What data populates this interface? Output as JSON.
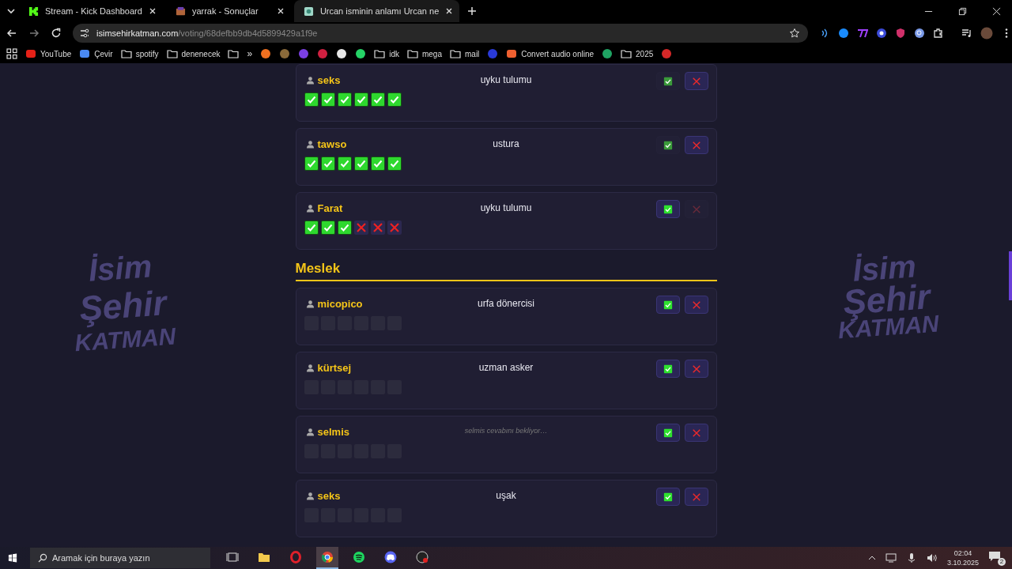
{
  "browser": {
    "tabs": [
      {
        "title": "Stream - Kick Dashboard",
        "selected": false
      },
      {
        "title": "yarrak - Sonuçlar",
        "selected": false
      },
      {
        "title": "Urcan isminin anlamı Urcan ne",
        "selected": true
      }
    ],
    "url": {
      "domain": "isimsehirkatman.com",
      "path": "/voting/68defbb9db4d5899429a1f9e"
    },
    "bookmarks": [
      {
        "kind": "site",
        "label": "YouTube",
        "color": "#e62117"
      },
      {
        "kind": "site",
        "label": "Çevir",
        "color": "#4a8af4"
      },
      {
        "kind": "folder",
        "label": "spotify"
      },
      {
        "kind": "folder",
        "label": "denenecek"
      },
      {
        "kind": "folder"
      },
      {
        "kind": "more",
        "label": "»"
      },
      {
        "kind": "icon",
        "color": "#f07020"
      },
      {
        "kind": "icon",
        "color": "#8a6a3a"
      },
      {
        "kind": "icon",
        "color": "#7b3fe4"
      },
      {
        "kind": "icon",
        "color": "#d02040"
      },
      {
        "kind": "icon",
        "color": "#e8e8e8"
      },
      {
        "kind": "icon",
        "color": "#25d366"
      },
      {
        "kind": "folder",
        "label": "idk"
      },
      {
        "kind": "folder",
        "label": "mega"
      },
      {
        "kind": "folder",
        "label": "mail"
      },
      {
        "kind": "icon",
        "color": "#2a3ad8"
      },
      {
        "kind": "site",
        "label": "Convert audio online",
        "color": "#f06030"
      },
      {
        "kind": "icon",
        "color": "#1fa463"
      },
      {
        "kind": "folder",
        "label": "2025"
      },
      {
        "kind": "icon",
        "color": "#d62828"
      }
    ]
  },
  "background_logos": [
    {
      "lines": [
        "İsim",
        "Şehir",
        "KATMAN"
      ]
    },
    {
      "lines": [
        "İsim",
        "Şehir",
        "KATMAN"
      ]
    }
  ],
  "sections": [
    {
      "cards": [
        {
          "name": "seks",
          "answer": "uyku tulumu",
          "pending": false,
          "approve_on": false,
          "reject_on": true,
          "votes": [
            {
              "kind": "yes"
            },
            {
              "kind": "yes"
            },
            {
              "kind": "yes"
            },
            {
              "kind": "yes"
            },
            {
              "kind": "yes"
            },
            {
              "kind": "yes"
            }
          ]
        },
        {
          "name": "tawso",
          "answer": "ustura",
          "pending": false,
          "approve_on": false,
          "reject_on": true,
          "votes": [
            {
              "kind": "yes"
            },
            {
              "kind": "yes"
            },
            {
              "kind": "yes"
            },
            {
              "kind": "yes"
            },
            {
              "kind": "yes"
            },
            {
              "kind": "yes"
            }
          ]
        },
        {
          "name": "Farat",
          "answer": "uyku tulumu",
          "pending": false,
          "approve_on": true,
          "reject_on": false,
          "votes": [
            {
              "kind": "yes"
            },
            {
              "kind": "yes"
            },
            {
              "kind": "yes"
            },
            {
              "kind": "no"
            },
            {
              "kind": "no"
            },
            {
              "kind": "no"
            }
          ]
        }
      ]
    },
    {
      "heading": "Meslek",
      "cards": [
        {
          "name": "micopico",
          "answer": "urfa dönercisi",
          "pending": false,
          "approve_on": true,
          "reject_on": true,
          "votes": [
            {
              "kind": "empty"
            },
            {
              "kind": "empty"
            },
            {
              "kind": "empty"
            },
            {
              "kind": "empty"
            },
            {
              "kind": "empty"
            },
            {
              "kind": "empty"
            }
          ]
        },
        {
          "name": "kürtsej",
          "answer": "uzman asker",
          "pending": false,
          "approve_on": true,
          "reject_on": true,
          "votes": [
            {
              "kind": "empty"
            },
            {
              "kind": "empty"
            },
            {
              "kind": "empty"
            },
            {
              "kind": "empty"
            },
            {
              "kind": "empty"
            },
            {
              "kind": "empty"
            }
          ]
        },
        {
          "name": "selmis",
          "answer": "selmis cevabını bekliyor…",
          "pending": true,
          "approve_on": true,
          "reject_on": true,
          "votes": [
            {
              "kind": "empty"
            },
            {
              "kind": "empty"
            },
            {
              "kind": "empty"
            },
            {
              "kind": "empty"
            },
            {
              "kind": "empty"
            },
            {
              "kind": "empty"
            }
          ]
        },
        {
          "name": "seks",
          "answer": "uşak",
          "pending": false,
          "approve_on": true,
          "reject_on": true,
          "votes": [
            {
              "kind": "empty"
            },
            {
              "kind": "empty"
            },
            {
              "kind": "empty"
            },
            {
              "kind": "empty"
            },
            {
              "kind": "empty"
            },
            {
              "kind": "empty"
            }
          ]
        }
      ]
    }
  ],
  "taskbar": {
    "search_placeholder": "Aramak için buraya yazın",
    "apps": [
      {
        "kind": "taskview",
        "active": false
      },
      {
        "kind": "files",
        "active": false
      },
      {
        "kind": "opera",
        "active": false
      },
      {
        "kind": "chrome",
        "active": true
      },
      {
        "kind": "spotify",
        "active": false
      },
      {
        "kind": "discord",
        "active": false
      },
      {
        "kind": "obs",
        "active": false
      }
    ],
    "time": "02:04",
    "date": "3.10.2025",
    "notifications": "2"
  }
}
